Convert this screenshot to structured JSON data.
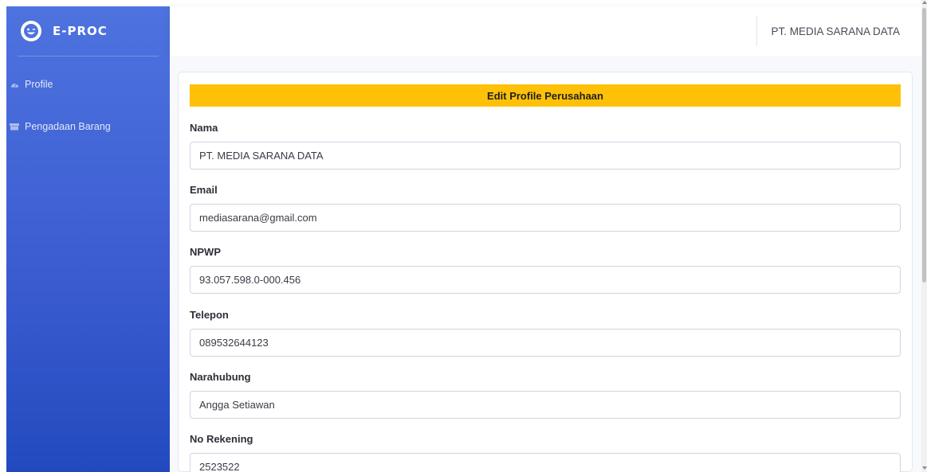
{
  "sidebar": {
    "brand": {
      "icon": "laugh-wink-icon",
      "title": "E-PROC"
    },
    "items": [
      {
        "label": "Profile",
        "icon": "tachometer-icon"
      },
      {
        "label": "Pengadaan Barang",
        "icon": "box-icon"
      }
    ]
  },
  "topbar": {
    "user_name": "PT. MEDIA SARANA DATA"
  },
  "form": {
    "header": "Edit Profile Perusahaan",
    "fields": [
      {
        "label": "Nama",
        "value": "PT. MEDIA SARANA DATA"
      },
      {
        "label": "Email",
        "value": "mediasarana@gmail.com"
      },
      {
        "label": "NPWP",
        "value": "93.057.598.0-000.456"
      },
      {
        "label": "Telepon",
        "value": "089532644123"
      },
      {
        "label": "Narahubung",
        "value": "Angga Setiawan"
      },
      {
        "label": "No Rekening",
        "value": "2523522"
      }
    ]
  },
  "colors": {
    "sidebar_top": "#4e73df",
    "sidebar_bottom": "#224abe",
    "card_header": "#ffc107"
  }
}
